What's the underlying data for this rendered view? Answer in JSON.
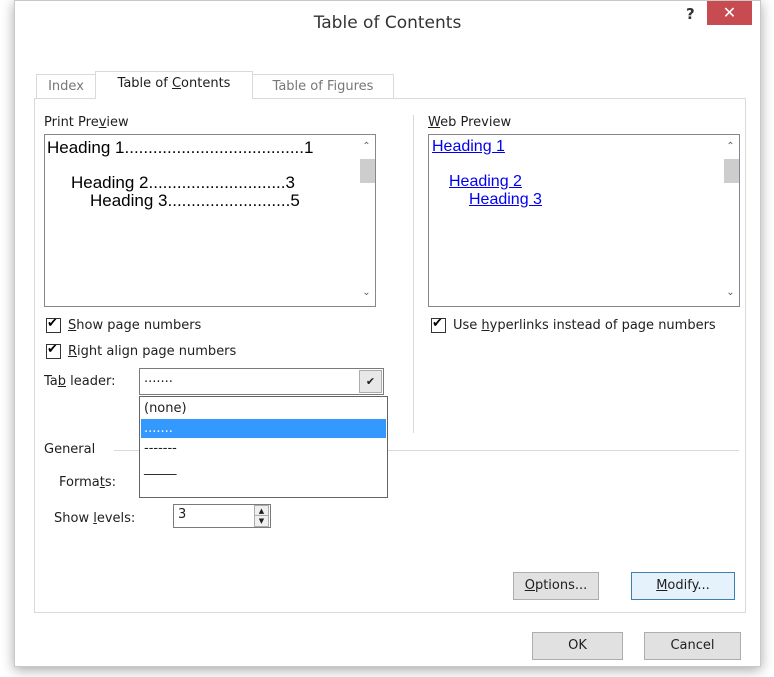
{
  "window": {
    "title": "Table of Contents",
    "help_label": "?",
    "close_label": "✕"
  },
  "tabs": [
    {
      "label_pre": "Index",
      "label_u": "",
      "label_post": ""
    },
    {
      "label_pre": "Table of ",
      "label_u": "C",
      "label_post": "ontents"
    },
    {
      "label_pre": "Table of Figures",
      "label_u": "",
      "label_post": ""
    }
  ],
  "print_preview": {
    "label_pre": "Print Pre",
    "label_u": "v",
    "label_post": "iew",
    "lines": [
      {
        "text": "Heading 1",
        "leader": "......................................",
        "page": "1"
      },
      {
        "text": "Heading 2",
        "leader": ".............................",
        "page": "3"
      },
      {
        "text": "Heading 3",
        "leader": "..........................",
        "page": "5"
      }
    ]
  },
  "web_preview": {
    "label_pre": "",
    "label_u": "W",
    "label_post": "eb Preview",
    "links": [
      "Heading 1",
      "Heading 2",
      "Heading 3"
    ]
  },
  "options": {
    "show_page_numbers": {
      "pre": "",
      "u": "S",
      "post": "how page numbers",
      "checked": true
    },
    "right_align": {
      "pre": "",
      "u": "R",
      "post": "ight align page numbers",
      "checked": true
    },
    "use_hyperlinks": {
      "pre": "Use ",
      "u": "h",
      "post": "yperlinks instead of page numbers",
      "checked": true
    }
  },
  "tab_leader": {
    "label_pre": "Ta",
    "label_u": "b",
    "label_post": " leader:",
    "value": ".......",
    "options": [
      "(none)",
      ".......",
      "-------",
      "_____"
    ],
    "selected_index": 1
  },
  "general": {
    "label": "General",
    "formats_label_pre": "Forma",
    "formats_label_u": "t",
    "formats_label_post": "s:",
    "show_levels_label_pre": "Show ",
    "show_levels_label_u": "l",
    "show_levels_label_post": "evels:",
    "show_levels_value": "3"
  },
  "buttons": {
    "options_pre": "",
    "options_u": "O",
    "options_post": "ptions...",
    "modify_pre": "",
    "modify_u": "M",
    "modify_post": "odify...",
    "ok": "OK",
    "cancel": "Cancel"
  },
  "colors": {
    "close_button": "#c74b50",
    "selection": "#3399ff",
    "hyperlink": "#0000ee"
  }
}
